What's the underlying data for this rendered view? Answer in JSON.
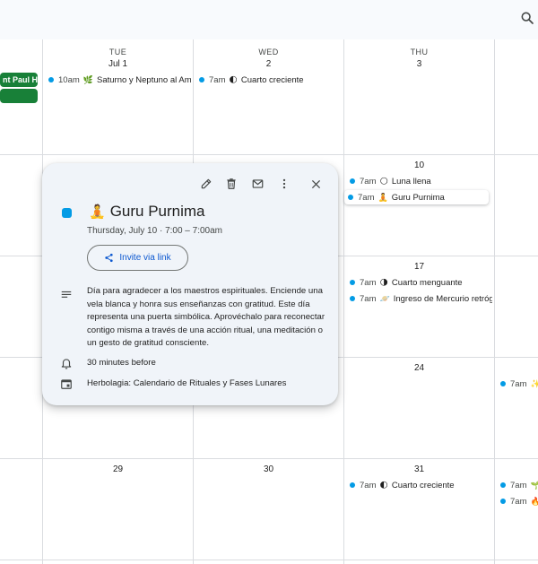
{
  "days": {
    "tue": {
      "name": "TUE",
      "num": "Jul 1"
    },
    "wed": {
      "name": "WED",
      "num": "2"
    },
    "thu": {
      "name": "THU",
      "num": "3"
    }
  },
  "day_numbers": {
    "r2_thu": "10",
    "r3_thu": "17",
    "r4_thu": "24",
    "r5_tue": "29",
    "r5_wed": "30",
    "r5_thu": "31"
  },
  "allday_event": "nt Paul H",
  "events": {
    "r1_tue": {
      "time": "10am",
      "title": "Saturno y Neptuno al Ama"
    },
    "r1_wed": {
      "time": "7am",
      "title": "Cuarto creciente"
    },
    "r2_thu_a": {
      "time": "7am",
      "title": "Luna llena"
    },
    "r2_thu_b": {
      "time": "7am",
      "title": "Guru Purnima"
    },
    "r3_thu_a": {
      "time": "7am",
      "title": "Cuarto menguante"
    },
    "r3_thu_b": {
      "time": "7am",
      "title": "Ingreso de Mercurio retróg"
    },
    "r4_fri": {
      "time": "7am",
      "title": ""
    },
    "r5_thu": {
      "time": "7am",
      "title": "Cuarto creciente"
    },
    "r5_fri_a": {
      "time": "7am",
      "title": ""
    },
    "r5_fri_b": {
      "time": "7am",
      "title": ""
    }
  },
  "popover": {
    "title": "Guru Purnima",
    "date": "Thursday, July 10  ·  7:00 – 7:00am",
    "invite_label": "Invite via link",
    "description": "Día para agradecer a los maestros espirituales. Enciende una vela blanca y honra sus enseñanzas con gratitud. Este día representa una puerta simbólica. Aprovéchalo para reconectar contigo misma a través de una acción ritual, una meditación o un gesto de gratitud consciente.",
    "reminder": "30 minutes before",
    "calendar": "Herbolagia: Calendario de Rituales y Fases Lunares"
  },
  "colors": {
    "event_dot": "#039be5",
    "allday_bg": "#188038",
    "accent_blue": "#0b57d0"
  }
}
